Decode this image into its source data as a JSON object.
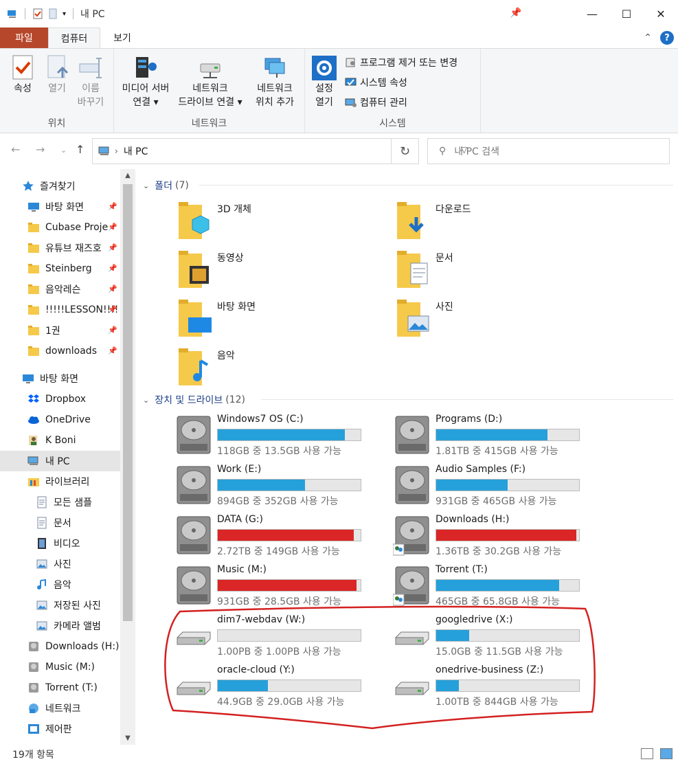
{
  "window": {
    "title": "내 PC"
  },
  "ribbon": {
    "tabs": [
      "파일",
      "컴퓨터",
      "보기"
    ],
    "groups": {
      "location": {
        "label": "위치",
        "buttons": [
          {
            "label": "속성"
          },
          {
            "label": "열기"
          },
          {
            "label_line1": "이름",
            "label_line2": "바꾸기"
          }
        ]
      },
      "network": {
        "label": "네트워크",
        "buttons": [
          {
            "label_line1": "미디어 서버",
            "label_line2": "연결 ▾"
          },
          {
            "label_line1": "네트워크",
            "label_line2": "드라이브 연결 ▾"
          },
          {
            "label_line1": "네트워크",
            "label_line2": "위치 추가"
          }
        ]
      },
      "system": {
        "label": "시스템",
        "open_settings": {
          "label_line1": "설정",
          "label_line2": "열기"
        },
        "items": [
          "프로그램 제거 또는 변경",
          "시스템 속성",
          "컴퓨터 관리"
        ]
      }
    }
  },
  "address": {
    "path": "내 PC",
    "search_placeholder": "내 PC 검색"
  },
  "sidebar": {
    "items": [
      {
        "label": "즐겨찾기",
        "icon": "star-icon",
        "pinned": false
      },
      {
        "label": "바탕 화면",
        "icon": "desktop-icon",
        "pinned": true
      },
      {
        "label": "Cubase Proje",
        "icon": "folder-icon",
        "pinned": true
      },
      {
        "label": "유튜브 재즈호",
        "icon": "folder-icon",
        "pinned": true
      },
      {
        "label": "Steinberg",
        "icon": "folder-icon",
        "pinned": true
      },
      {
        "label": "음악레슨",
        "icon": "folder-icon",
        "pinned": true
      },
      {
        "label": "!!!!!LESSON!!!!",
        "icon": "folder-icon",
        "pinned": true
      },
      {
        "label": "1권",
        "icon": "folder-icon",
        "pinned": true
      },
      {
        "label": "downloads",
        "icon": "folder-icon",
        "pinned": true
      },
      {
        "label": "바탕 화면",
        "icon": "desktop-icon",
        "pinned": false
      },
      {
        "label": "Dropbox",
        "icon": "dropbox-icon",
        "pinned": false
      },
      {
        "label": "OneDrive",
        "icon": "cloud-icon",
        "pinned": false
      },
      {
        "label": "K Boni",
        "icon": "user-icon",
        "pinned": false
      },
      {
        "label": "내 PC",
        "icon": "pc-icon",
        "pinned": false,
        "selected": true
      },
      {
        "label": "라이브러리",
        "icon": "library-icon",
        "pinned": false
      },
      {
        "label": "모든 샘플",
        "icon": "doc-icon",
        "pinned": false
      },
      {
        "label": "문서",
        "icon": "doc-icon",
        "pinned": false
      },
      {
        "label": "비디오",
        "icon": "video-icon",
        "pinned": false
      },
      {
        "label": "사진",
        "icon": "picture-icon",
        "pinned": false
      },
      {
        "label": "음악",
        "icon": "music-icon",
        "pinned": false
      },
      {
        "label": "저장된 사진",
        "icon": "picture-icon",
        "pinned": false
      },
      {
        "label": "카메라 앨범",
        "icon": "picture-icon",
        "pinned": false
      },
      {
        "label": "Downloads (H:)",
        "icon": "drive-icon",
        "pinned": false
      },
      {
        "label": "Music (M:)",
        "icon": "drive-icon",
        "pinned": false
      },
      {
        "label": "Torrent (T:)",
        "icon": "drive-icon",
        "pinned": false
      },
      {
        "label": "네트워크",
        "icon": "network-icon",
        "pinned": false
      },
      {
        "label": "제어판",
        "icon": "control-panel-icon",
        "pinned": false
      }
    ]
  },
  "folders_section": {
    "title": "폴더",
    "count": "(7)"
  },
  "folders": [
    {
      "name": "3D 개체",
      "icon": "3d-objects-icon"
    },
    {
      "name": "다운로드",
      "icon": "downloads-icon"
    },
    {
      "name": "동영상",
      "icon": "videos-icon"
    },
    {
      "name": "문서",
      "icon": "documents-icon"
    },
    {
      "name": "바탕 화면",
      "icon": "desktop-folder-icon"
    },
    {
      "name": "사진",
      "icon": "pictures-icon"
    },
    {
      "name": "음악",
      "icon": "music-folder-icon"
    }
  ],
  "drives_section": {
    "title": "장치 및 드라이브",
    "count": "(12)"
  },
  "drives": [
    {
      "name": "Windows7 OS (C:)",
      "info": "118GB 중 13.5GB 사용 가능",
      "used_fraction": 0.89,
      "color": "#26a0da",
      "kind": "hdd"
    },
    {
      "name": "Programs (D:)",
      "info": "1.81TB 중 415GB 사용 가능",
      "used_fraction": 0.78,
      "color": "#26a0da",
      "kind": "hdd"
    },
    {
      "name": "Work (E:)",
      "info": "894GB 중 352GB 사용 가능",
      "used_fraction": 0.61,
      "color": "#26a0da",
      "kind": "hdd"
    },
    {
      "name": "Audio Samples (F:)",
      "info": "931GB 중 465GB 사용 가능",
      "used_fraction": 0.5,
      "color": "#26a0da",
      "kind": "hdd"
    },
    {
      "name": "DATA (G:)",
      "info": "2.72TB 중 149GB 사용 가능",
      "used_fraction": 0.95,
      "color": "#da2626",
      "kind": "hdd"
    },
    {
      "name": "Downloads (H:)",
      "info": "1.36TB 중 30.2GB 사용 가능",
      "used_fraction": 0.98,
      "color": "#da2626",
      "kind": "hdd-shared"
    },
    {
      "name": "Music (M:)",
      "info": "931GB 중 28.5GB 사용 가능",
      "used_fraction": 0.97,
      "color": "#da2626",
      "kind": "hdd"
    },
    {
      "name": "Torrent (T:)",
      "info": "465GB 중 65.8GB 사용 가능",
      "used_fraction": 0.86,
      "color": "#26a0da",
      "kind": "hdd-shared"
    },
    {
      "name": "dim7-webdav (W:)",
      "info": "1.00PB 중 1.00PB 사용 가능",
      "used_fraction": 0.0,
      "color": "#26a0da",
      "kind": "network"
    },
    {
      "name": "googledrive (X:)",
      "info": "15.0GB 중 11.5GB 사용 가능",
      "used_fraction": 0.23,
      "color": "#26a0da",
      "kind": "network"
    },
    {
      "name": "oracle-cloud (Y:)",
      "info": "44.9GB 중 29.0GB 사용 가능",
      "used_fraction": 0.35,
      "color": "#26a0da",
      "kind": "network"
    },
    {
      "name": "onedrive-business (Z:)",
      "info": "1.00TB 중 844GB 사용 가능",
      "used_fraction": 0.16,
      "color": "#26a0da",
      "kind": "network"
    }
  ],
  "status": {
    "item_count": "19개 항목"
  }
}
